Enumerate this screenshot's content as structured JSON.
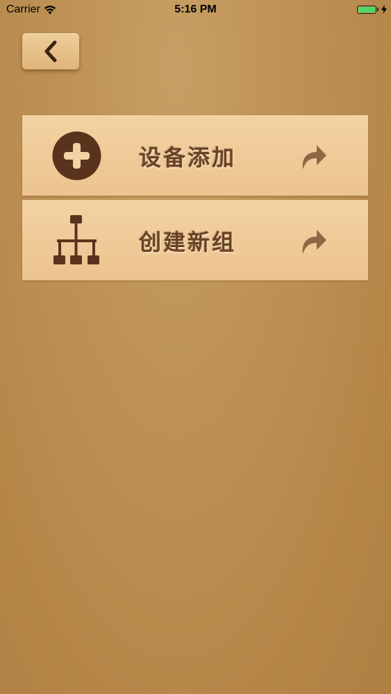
{
  "status_bar": {
    "carrier": "Carrier",
    "time": "5:16 PM"
  },
  "nav": {
    "back_icon": "chevron-left-icon"
  },
  "menu": {
    "items": [
      {
        "label": "设备添加",
        "icon": "plus-circle-icon",
        "trailing_icon": "share-arrow-icon"
      },
      {
        "label": "创建新组",
        "icon": "hierarchy-icon",
        "trailing_icon": "share-arrow-icon"
      }
    ]
  },
  "colors": {
    "background": "#b88a4c",
    "item_background": "#f0cb99",
    "icon_dark": "#5a331c",
    "label": "#6a4326",
    "arrow": "#8e6745",
    "battery": "#4cd964"
  }
}
